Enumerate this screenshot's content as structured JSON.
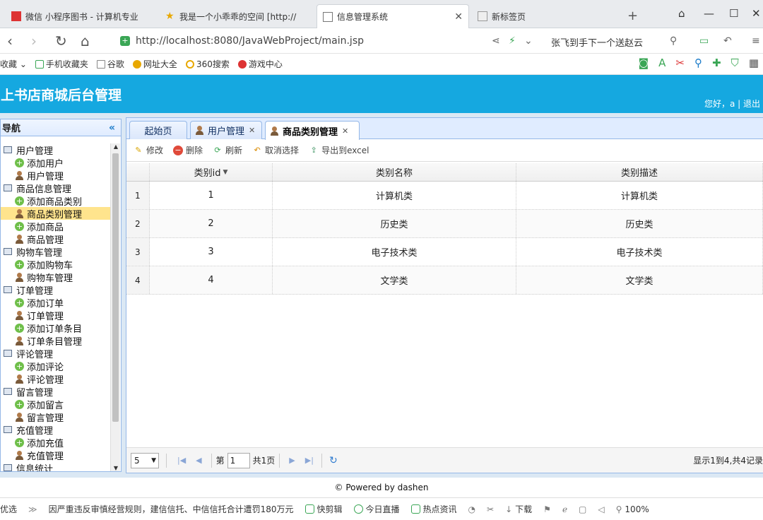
{
  "browser": {
    "tabs": [
      {
        "label": "微信 小程序图书 - 计算机专业",
        "active": false
      },
      {
        "label": "我是一个小乖乖的空间 [http://",
        "active": false
      },
      {
        "label": "信息管理系统",
        "active": true
      },
      {
        "label": "新标签页",
        "active": false
      }
    ],
    "url": "http://localhost:8080/JavaWebProject/main.jsp",
    "search_hint": "张飞到手下一个送赵云",
    "bookmarks": [
      "收藏",
      "手机收藏夹",
      "谷歌",
      "网址大全",
      "360搜索",
      "游戏中心"
    ]
  },
  "app": {
    "title": "网上书店商城后台管理",
    "greeting": "您好，a | 退出"
  },
  "sidebar": {
    "title": "导航",
    "groups": [
      {
        "label": "用户管理",
        "items": [
          {
            "label": "添加用户",
            "icon": "add-icon"
          },
          {
            "label": "用户管理",
            "icon": "user-icon"
          }
        ]
      },
      {
        "label": "商品信息管理",
        "items": [
          {
            "label": "添加商品类别",
            "icon": "add-icon"
          },
          {
            "label": "商品类别管理",
            "icon": "user-icon",
            "selected": true
          },
          {
            "label": "添加商品",
            "icon": "add-icon"
          },
          {
            "label": "商品管理",
            "icon": "user-icon"
          }
        ]
      },
      {
        "label": "购物车管理",
        "items": [
          {
            "label": "添加购物车",
            "icon": "add-icon"
          },
          {
            "label": "购物车管理",
            "icon": "user-icon"
          }
        ]
      },
      {
        "label": "订单管理",
        "items": [
          {
            "label": "添加订单",
            "icon": "add-icon"
          },
          {
            "label": "订单管理",
            "icon": "user-icon"
          },
          {
            "label": "添加订单条目",
            "icon": "add-icon"
          },
          {
            "label": "订单条目管理",
            "icon": "user-icon"
          }
        ]
      },
      {
        "label": "评论管理",
        "items": [
          {
            "label": "添加评论",
            "icon": "add-icon"
          },
          {
            "label": "评论管理",
            "icon": "user-icon"
          }
        ]
      },
      {
        "label": "留言管理",
        "items": [
          {
            "label": "添加留言",
            "icon": "add-icon"
          },
          {
            "label": "留言管理",
            "icon": "user-icon"
          }
        ]
      },
      {
        "label": "充值管理",
        "items": [
          {
            "label": "添加充值",
            "icon": "add-icon"
          },
          {
            "label": "充值管理",
            "icon": "user-icon"
          }
        ]
      },
      {
        "label": "信息统计",
        "items": []
      }
    ]
  },
  "tabs": [
    {
      "label": "起始页",
      "closable": false,
      "icon": ""
    },
    {
      "label": "用户管理",
      "closable": true,
      "icon": "user-icon"
    },
    {
      "label": "商品类别管理",
      "closable": true,
      "icon": "user-icon",
      "active": true
    }
  ],
  "toolbar": {
    "edit": "修改",
    "delete": "删除",
    "refresh": "刷新",
    "cancel_select": "取消选择",
    "export": "导出到excel"
  },
  "grid": {
    "columns": [
      "类别id",
      "类别名称",
      "类别描述"
    ],
    "rows": [
      {
        "n": "1",
        "id": "1",
        "name": "计算机类",
        "desc": "计算机类"
      },
      {
        "n": "2",
        "id": "2",
        "name": "历史类",
        "desc": "历史类"
      },
      {
        "n": "3",
        "id": "3",
        "name": "电子技术类",
        "desc": "电子技术类"
      },
      {
        "n": "4",
        "id": "4",
        "name": "文学类",
        "desc": "文学类"
      }
    ]
  },
  "pager": {
    "page_size": "5",
    "page_prefix": "第",
    "page_value": "1",
    "page_total": "共1页",
    "info": "显示1到4,共4记录"
  },
  "footer": "© Powered by dashen",
  "statusbar": {
    "left": "优选",
    "news": "因严重违反审慎经营规则，建信信托、中信信托合计遭罚180万元",
    "items": [
      "快剪辑",
      "今日直播",
      "热点资讯",
      "下载",
      "100%"
    ]
  }
}
